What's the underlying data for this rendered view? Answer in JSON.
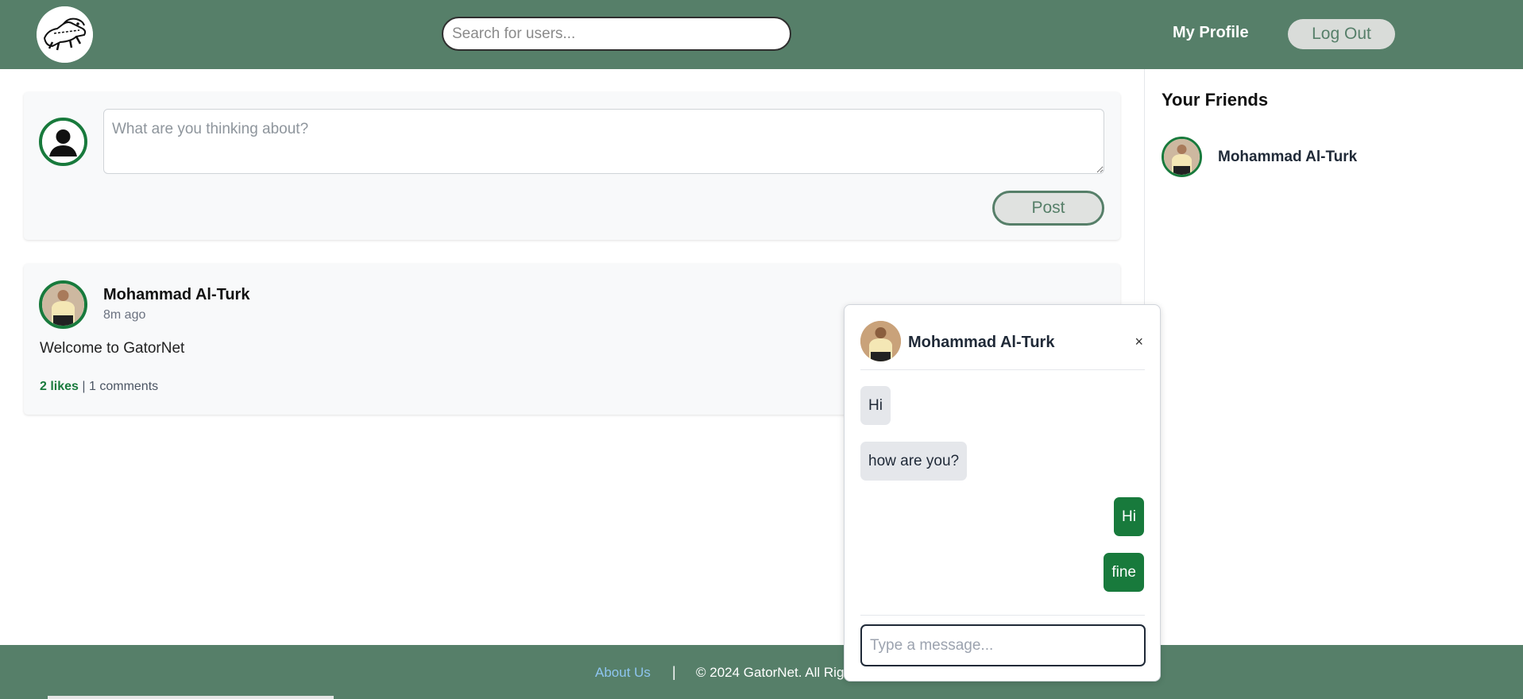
{
  "header": {
    "search_placeholder": "Search for users...",
    "my_profile": "My Profile",
    "logout": "Log Out"
  },
  "composer": {
    "placeholder": "What are you thinking about?",
    "post_button": "Post"
  },
  "feed": [
    {
      "author": "Mohammad Al-Turk",
      "time": "8m ago",
      "body": "Welcome to GatorNet",
      "likes": "2 likes",
      "separator": "|",
      "comments": "1 comments"
    }
  ],
  "sidebar": {
    "title": "Your Friends",
    "friends": [
      {
        "name": "Mohammad Al-Turk"
      }
    ]
  },
  "chat": {
    "name": "Mohammad Al-Turk",
    "close": "×",
    "messages": [
      {
        "text": "Hi",
        "dir": "in"
      },
      {
        "text": "how are you?",
        "dir": "in"
      },
      {
        "text": "Hi",
        "dir": "out"
      },
      {
        "text": "fine",
        "dir": "out"
      }
    ],
    "input_placeholder": "Type a message..."
  },
  "footer": {
    "about": "About Us",
    "separator": "|",
    "copyright": "© 2024 GatorNet. All Rig"
  },
  "colors": {
    "brand": "#567f69",
    "accent": "#187a3c",
    "link": "#8ec5f0"
  }
}
